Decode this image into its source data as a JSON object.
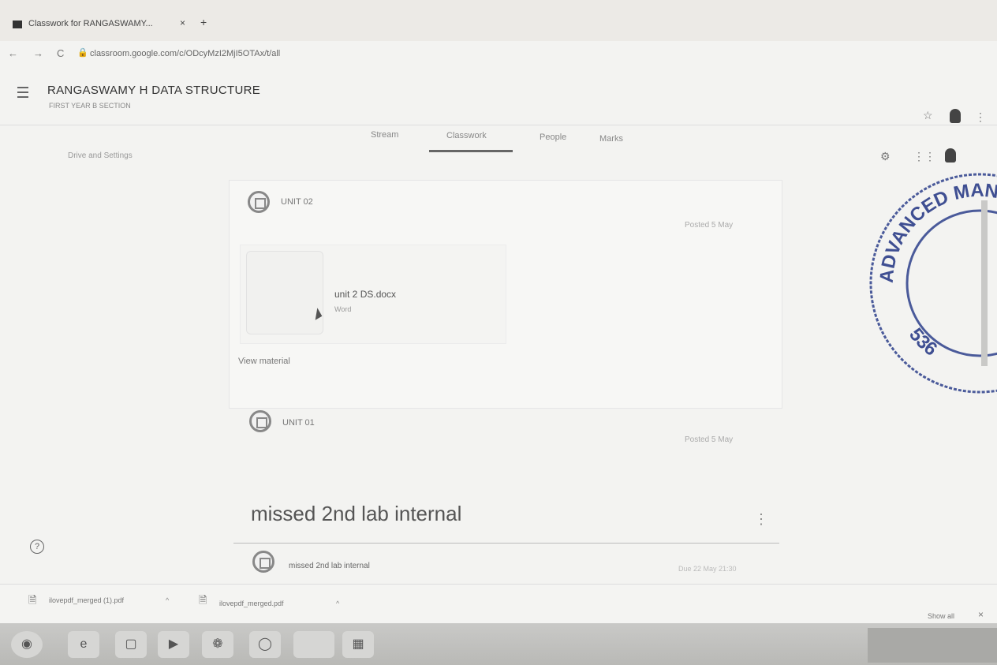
{
  "browser": {
    "tab_title": "Classwork for RANGASWAMY...",
    "tab_close": "×",
    "new_tab": "+",
    "url": "classroom.google.com/c/ODcyMzI2MjI5OTAx/t/all",
    "lock_icon": "lock-icon",
    "nav": {
      "back": "←",
      "forward": "→",
      "reload": "C"
    }
  },
  "header": {
    "class_name": "RANGASWAMY H DATA STRUCTURE",
    "section": "FIRST YEAR B SECTION",
    "tabs": [
      "Stream",
      "Classwork",
      "People",
      "Marks"
    ],
    "active_tab": "Classwork",
    "drive_link": "Drive and Settings"
  },
  "classwork": {
    "unit2": {
      "label": "UNIT 02",
      "posted": "Posted 5 May",
      "attachment_name": "unit 2 DS.docx",
      "attachment_type": "Word",
      "view_material": "View material"
    },
    "unit1": {
      "label": "UNIT 01",
      "posted": "Posted 5 May"
    },
    "topic": {
      "title": "missed 2nd lab internal",
      "item_label": "missed 2nd lab internal",
      "due": "Due 22 May 21:30",
      "menu": "⋮"
    }
  },
  "help": "?",
  "downloads": {
    "items": [
      "ilovepdf_merged (1).pdf",
      "ilovepdf_merged.pdf"
    ],
    "caret": "^",
    "show_all": "Show all",
    "close": "×"
  },
  "stamp": {
    "top_text": "ADVANCED MANAGEMENT",
    "bottom_text": "536"
  }
}
